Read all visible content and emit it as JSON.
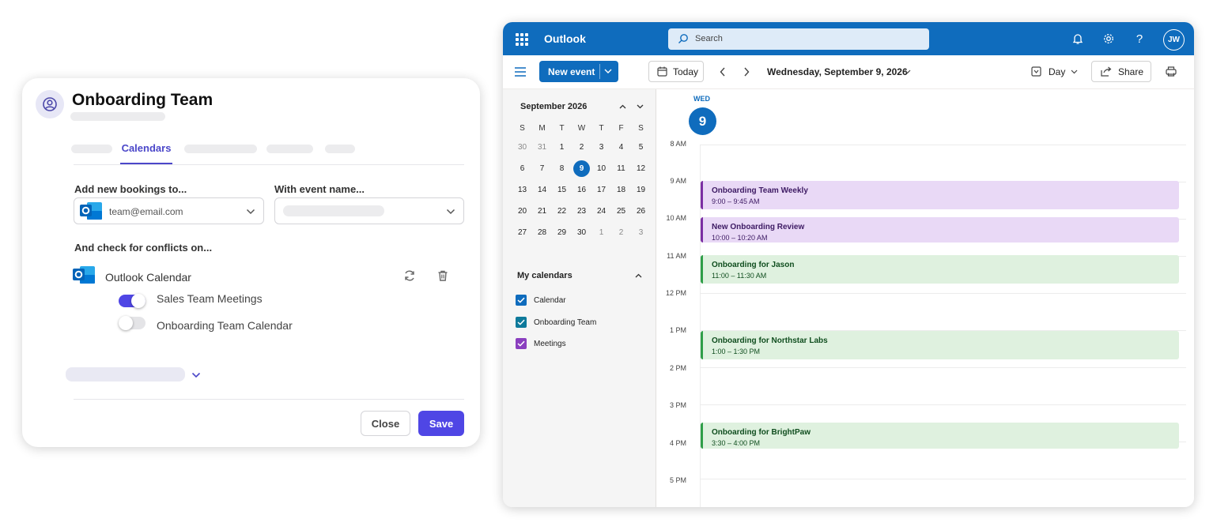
{
  "settings": {
    "title": "Onboarding Team",
    "active_tab": "Calendars",
    "bookings_label": "Add new bookings to...",
    "bookings_value": "team@email.com",
    "event_name_label": "With event name...",
    "conflicts_label": "And check for conflicts on...",
    "conflict_source": "Outlook Calendar",
    "toggles": [
      {
        "label": "Sales Team Meetings",
        "on": true
      },
      {
        "label": "Onboarding Team Calendar",
        "on": false
      }
    ],
    "close_label": "Close",
    "save_label": "Save",
    "accent_color": "#4f46e5"
  },
  "outlook": {
    "app_name": "Outlook",
    "search_placeholder": "Search",
    "user_initials": "JW",
    "new_event_label": "New event",
    "today_label": "Today",
    "date_title": "Wednesday, September 9, 2026",
    "view_label": "Day",
    "share_label": "Share",
    "mini_calendar": {
      "month": "September 2026",
      "weekdays": [
        "S",
        "M",
        "T",
        "W",
        "T",
        "F",
        "S"
      ],
      "weeks": [
        [
          "30",
          "31",
          "1",
          "2",
          "3",
          "4",
          "5"
        ],
        [
          "6",
          "7",
          "8",
          "9",
          "10",
          "11",
          "12"
        ],
        [
          "13",
          "14",
          "15",
          "16",
          "17",
          "18",
          "19"
        ],
        [
          "20",
          "21",
          "22",
          "23",
          "24",
          "25",
          "26"
        ],
        [
          "27",
          "28",
          "29",
          "30",
          "1",
          "2",
          "3"
        ]
      ],
      "selected": "9"
    },
    "my_calendars_label": "My calendars",
    "calendars": [
      {
        "name": "Calendar",
        "color": "#0f6cbd"
      },
      {
        "name": "Onboarding Team",
        "color": "#0e7a9b"
      },
      {
        "name": "Meetings",
        "color": "#8a3fbf"
      }
    ],
    "day": {
      "dow": "WED",
      "num": "9"
    },
    "hours": [
      "8 AM",
      "9 AM",
      "10 AM",
      "11 AM",
      "12 PM",
      "1 PM",
      "2 PM",
      "3 PM",
      "4 PM",
      "5 PM"
    ],
    "events": [
      {
        "title": "Onboarding Team Weekly",
        "time": "9:00 – 9:45 AM",
        "color": "purple"
      },
      {
        "title": "New Onboarding Review",
        "time": "10:00 – 10:20 AM",
        "color": "purple"
      },
      {
        "title": "Onboarding for Jason",
        "time": "11:00 – 11:30 AM",
        "color": "green"
      },
      {
        "title": "Onboarding for Northstar Labs",
        "time": "1:00 – 1:30 PM",
        "color": "green"
      },
      {
        "title": "Onboarding for BrightPaw",
        "time": "3:30 – 4:00 PM",
        "color": "green"
      }
    ]
  }
}
